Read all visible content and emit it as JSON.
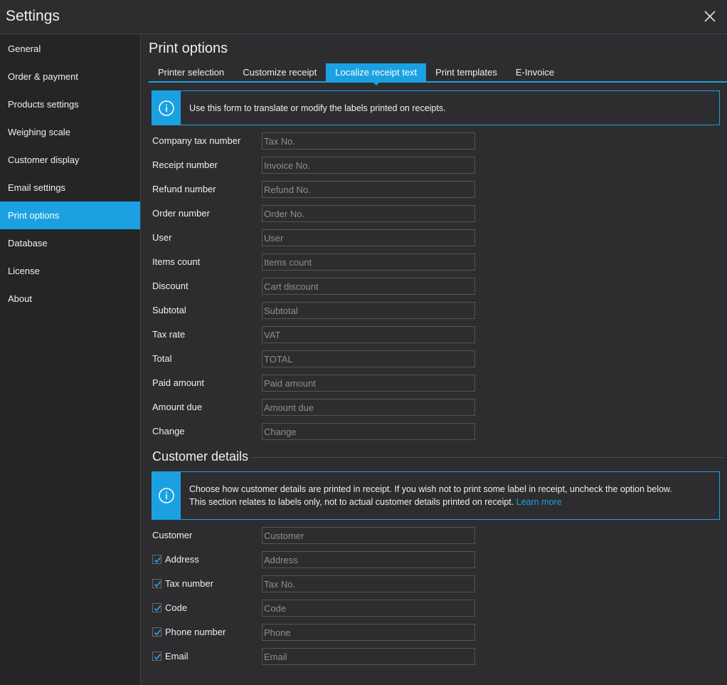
{
  "window": {
    "title": "Settings"
  },
  "sidebar": {
    "items": [
      {
        "label": "General",
        "active": false
      },
      {
        "label": "Order & payment",
        "active": false
      },
      {
        "label": "Products settings",
        "active": false
      },
      {
        "label": "Weighing scale",
        "active": false
      },
      {
        "label": "Customer display",
        "active": false
      },
      {
        "label": "Email settings",
        "active": false
      },
      {
        "label": "Print options",
        "active": true
      },
      {
        "label": "Database",
        "active": false
      },
      {
        "label": "License",
        "active": false
      },
      {
        "label": "About",
        "active": false
      }
    ]
  },
  "main": {
    "title": "Print options",
    "tabs": [
      {
        "label": "Printer selection",
        "active": false
      },
      {
        "label": "Customize receipt",
        "active": false
      },
      {
        "label": "Localize receipt text",
        "active": true
      },
      {
        "label": "Print templates",
        "active": false
      },
      {
        "label": "E-Invoice",
        "active": false
      }
    ],
    "info1": "Use this form to translate or modify the labels printed on receipts.",
    "fields": [
      {
        "label": "Company tax number",
        "placeholder": "Tax No.",
        "value": ""
      },
      {
        "label": "Receipt number",
        "placeholder": "Invoice No.",
        "value": ""
      },
      {
        "label": "Refund number",
        "placeholder": "Refund No.",
        "value": ""
      },
      {
        "label": "Order number",
        "placeholder": "Order No.",
        "value": ""
      },
      {
        "label": "User",
        "placeholder": "User",
        "value": ""
      },
      {
        "label": "Items count",
        "placeholder": "Items count",
        "value": ""
      },
      {
        "label": "Discount",
        "placeholder": "Cart discount",
        "value": ""
      },
      {
        "label": "Subtotal",
        "placeholder": "Subtotal",
        "value": ""
      },
      {
        "label": "Tax rate",
        "placeholder": "VAT",
        "value": ""
      },
      {
        "label": "Total",
        "placeholder": "TOTAL",
        "value": ""
      },
      {
        "label": "Paid amount",
        "placeholder": "Paid amount",
        "value": ""
      },
      {
        "label": "Amount due",
        "placeholder": "Amount due",
        "value": ""
      },
      {
        "label": "Change",
        "placeholder": "Change",
        "value": ""
      }
    ],
    "customer_section": {
      "title": "Customer details",
      "info_line1": "Choose how customer details are printed in receipt. If you wish not to print some label in receipt, uncheck the option below.",
      "info_line2": "This section relates to labels only, not to actual customer details printed on receipt.",
      "learn_more": "Learn more",
      "fields": [
        {
          "label": "Customer",
          "placeholder": "Customer",
          "has_checkbox": false,
          "checked": false
        },
        {
          "label": "Address",
          "placeholder": "Address",
          "has_checkbox": true,
          "checked": true
        },
        {
          "label": "Tax number",
          "placeholder": "Tax No.",
          "has_checkbox": true,
          "checked": true
        },
        {
          "label": "Code",
          "placeholder": "Code",
          "has_checkbox": true,
          "checked": true
        },
        {
          "label": "Phone number",
          "placeholder": "Phone",
          "has_checkbox": true,
          "checked": true
        },
        {
          "label": "Email",
          "placeholder": "Email",
          "has_checkbox": true,
          "checked": true
        }
      ]
    }
  },
  "colors": {
    "accent": "#1ba1e2",
    "background": "#2d2d30",
    "sidebar": "#252526"
  },
  "icons": {
    "close": "close-icon",
    "info": "info-icon",
    "check": "checkmark-icon"
  }
}
